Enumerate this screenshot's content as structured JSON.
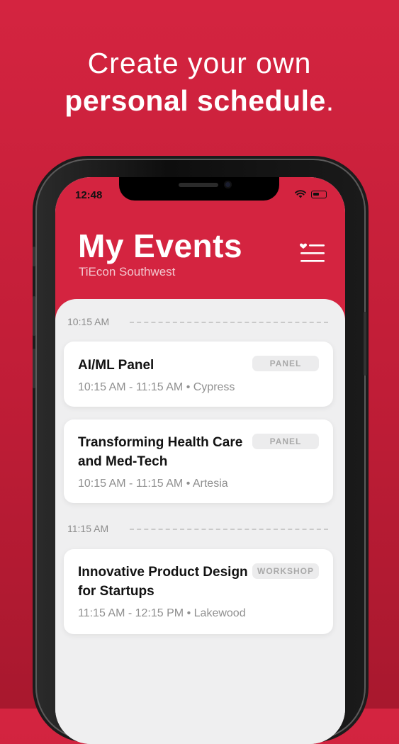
{
  "headline": {
    "line1": "Create your own",
    "line2": "personal schedule",
    "period": "."
  },
  "status_bar": {
    "time": "12:48"
  },
  "header": {
    "title": "My Events",
    "subtitle": "TiEcon Southwest"
  },
  "colors": {
    "brand": "#d42440",
    "card": "#ffffff",
    "content_bg": "#efeff0",
    "muted": "#8f8f8f"
  },
  "schedule": [
    {
      "time_label": "10:15 AM",
      "events": [
        {
          "title": "AI/ML Panel",
          "time_range": "10:15 AM - 11:15 AM",
          "separator": "•",
          "location": "Cypress",
          "tag": "PANEL"
        },
        {
          "title": "Transforming Health Care and Med-Tech",
          "time_range": "10:15 AM - 11:15 AM",
          "separator": "•",
          "location": "Artesia",
          "tag": "PANEL"
        }
      ]
    },
    {
      "time_label": "11:15 AM",
      "events": [
        {
          "title": "Innovative Product Design for Startups",
          "time_range": "11:15 AM - 12:15 PM",
          "separator": "•",
          "location": "Lakewood",
          "tag": "WORKSHOP"
        }
      ]
    }
  ],
  "icons": {
    "menu": "heart-list-icon",
    "wifi": "wifi-icon",
    "battery": "battery-icon"
  }
}
